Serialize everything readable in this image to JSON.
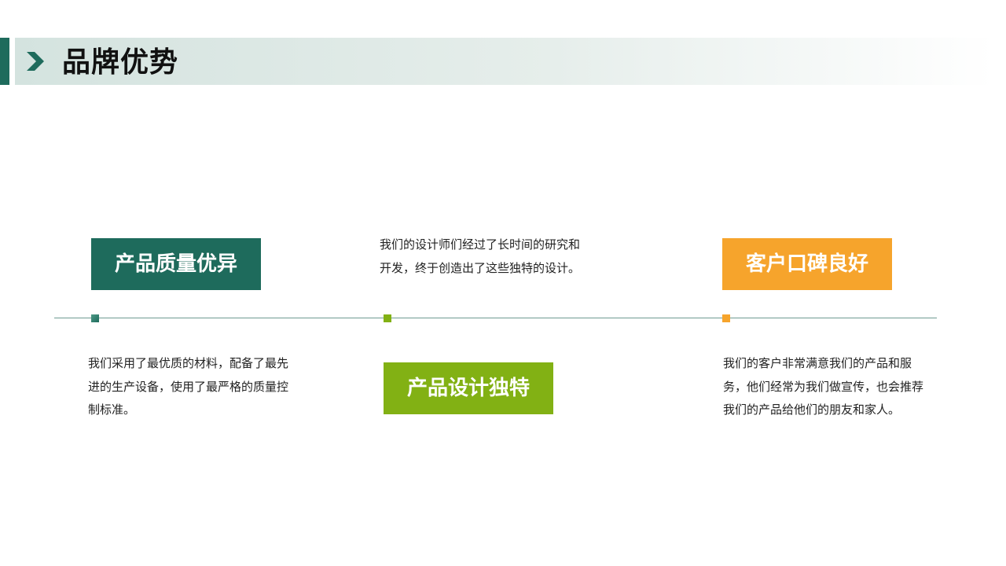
{
  "header": {
    "title": "品牌优势",
    "icon": "chevron-right-icon",
    "accent_color": "#1e6b5c"
  },
  "timeline": {
    "items": [
      {
        "label": "产品质量优异",
        "description": "我们采用了最优质的材料，配备了最先进的生产设备，使用了最严格的质量控制标准。",
        "color": "#1e6b5c"
      },
      {
        "label": "产品设计独特",
        "description": "我们的设计师们经过了长时间的研究和开发，终于创造出了这些独特的设计。",
        "color": "#82b114"
      },
      {
        "label": "客户口碑良好",
        "description": "我们的客户非常满意我们的产品和服务，他们经常为我们做宣传，也会推荐我们的产品给他们的朋友和家人。",
        "color": "#f6a42c"
      }
    ]
  }
}
